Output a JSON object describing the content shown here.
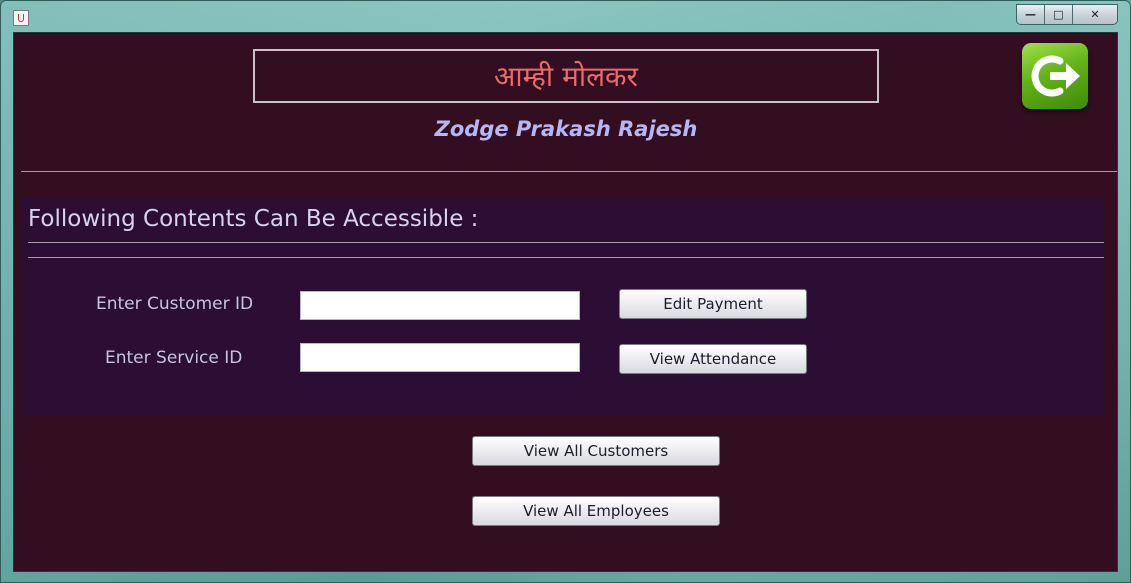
{
  "window": {
    "controls": {
      "minimize": "—",
      "maximize": "□",
      "close": "✕"
    }
  },
  "header": {
    "title": "आम्ही मोलकर",
    "subtitle": "Zodge Prakash Rajesh",
    "exit_icon": "logout-icon",
    "accent": "#63b317"
  },
  "panel": {
    "heading": "Following Contents Can Be Accessible :",
    "customer_label": "Enter Customer ID",
    "customer_value": "",
    "service_label": "Enter Service ID",
    "service_value": "",
    "edit_payment": "Edit Payment",
    "view_attendance": "View Attendance"
  },
  "actions": {
    "view_customers": "View All Customers",
    "view_employees": "View All Employees"
  },
  "colors": {
    "background": "#320e20",
    "panel": "#2c0d33",
    "title": "#e86a6a",
    "subtitle": "#b6b6f4"
  }
}
